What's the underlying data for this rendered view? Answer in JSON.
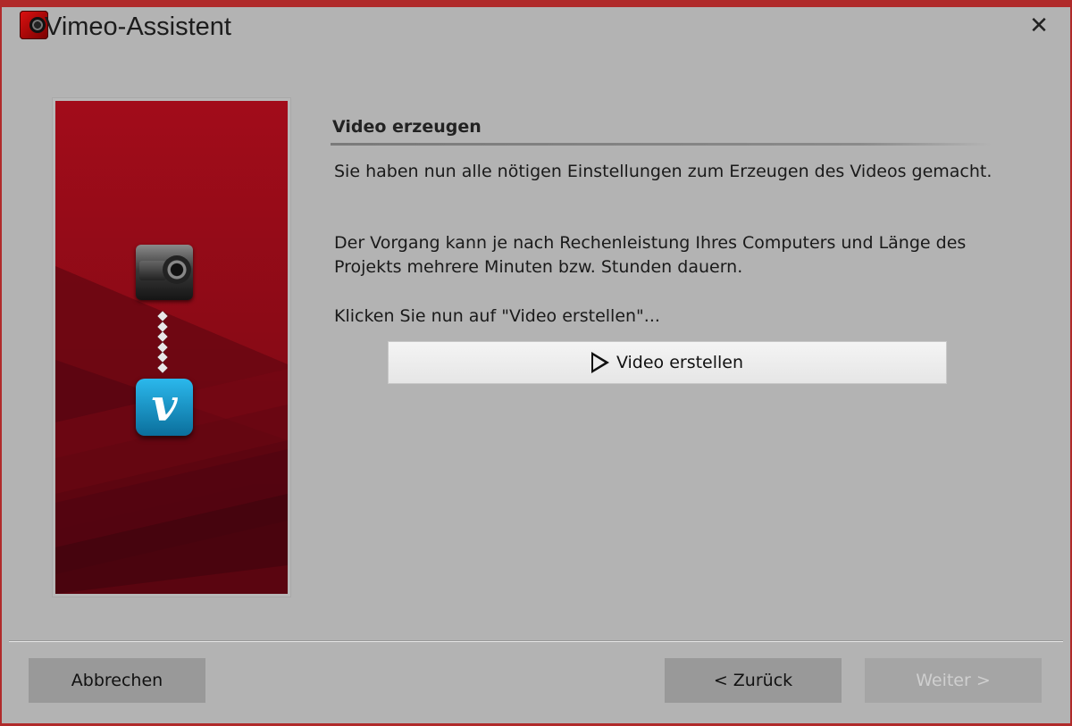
{
  "window": {
    "title": "Vimeo-Assistent",
    "close_glyph": "✕",
    "accent_color": "#b02a2a"
  },
  "sidebar_art": {
    "icons": [
      "camera-icon",
      "vimeo-icon"
    ],
    "vimeo_glyph": "v",
    "background_color": "#9a0d1a"
  },
  "content": {
    "heading": "Video erzeugen",
    "paragraph_1": "Sie haben nun alle nötigen Einstellungen zum Erzeugen des Videos gemacht.",
    "paragraph_2": "Der Vorgang kann je nach Rechenleistung Ihres Computers und Länge des Projekts mehrere Minuten bzw. Stunden dauern.",
    "paragraph_3": "Klicken Sie nun auf \"Video erstellen\"...",
    "create_button_label": "Video erstellen",
    "create_button_icon": "play-icon"
  },
  "footer": {
    "cancel_label": "Abbrechen",
    "back_label": "< Zurück",
    "next_label": "Weiter >",
    "next_enabled": false
  }
}
